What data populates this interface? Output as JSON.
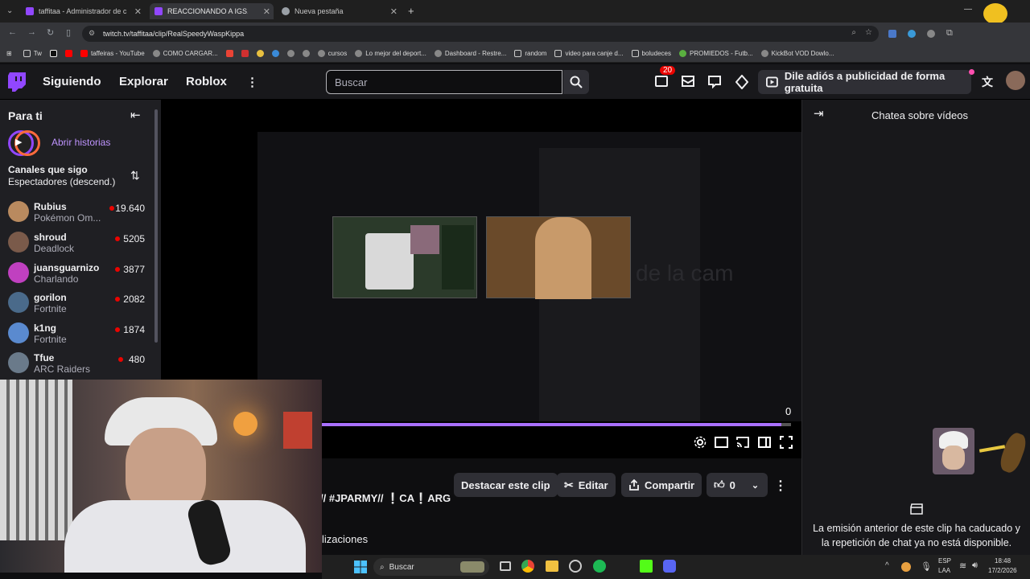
{
  "browser": {
    "tabs": [
      {
        "title": "taffitaa - Administrador de clip",
        "active": false
      },
      {
        "title": "REACCIONANDO A IGS...",
        "active": true
      },
      {
        "title": "Nueva pestaña",
        "active": false
      }
    ],
    "url": "twitch.tv/taffitaa/clip/RealSpeedyWaspKippa",
    "bookmarks": [
      "Tw",
      "taffeiras - YouTube",
      "COMO CARGAR...",
      "cursos",
      "Lo mejor del deport...",
      "Dashboard - Restre...",
      "random",
      "video para canje d...",
      "boludeces",
      "PROMIEDOS - Futb...",
      "KickBot VOD Dowlo..."
    ]
  },
  "topnav": {
    "links": [
      "Siguiendo",
      "Explorar",
      "Roblox"
    ],
    "search_placeholder": "Buscar",
    "notif_count": "20",
    "ad_label": "Dile adiós a publicidad de forma gratuita"
  },
  "sidebar": {
    "title": "Para ti",
    "stories_label": "Abrir historias",
    "section_title": "Canales que sigo",
    "sort_label": "Espectadores (descend.)",
    "channels": [
      {
        "name": "Rubius",
        "game": "Pokémon Om...",
        "viewers": "19.640",
        "color": "#b98a5f"
      },
      {
        "name": "shroud",
        "game": "Deadlock",
        "viewers": "5205",
        "color": "#7a5a4a"
      },
      {
        "name": "juansguarnizo",
        "game": "Charlando",
        "viewers": "3877",
        "color": "#c040c0"
      },
      {
        "name": "gorilon",
        "game": "Fortnite",
        "viewers": "2082",
        "color": "#4a6a8a"
      },
      {
        "name": "k1ng",
        "game": "Fortnite",
        "viewers": "1874",
        "color": "#5a8acf"
      },
      {
        "name": "Tfue",
        "game": "ARC Raiders",
        "viewers": "480",
        "color": "#6a7a8a"
      }
    ]
  },
  "player": {
    "counter": "0",
    "overlay_text": "de la cam",
    "progress_percent": 98
  },
  "clip_info": {
    "title_fragment": "// #JPARMY// ❕CA❕ARG",
    "views_fragment": "lizaciones",
    "buttons": {
      "highlight": "Destacar este clip",
      "edit": "Editar",
      "share": "Compartir",
      "likes": "0"
    }
  },
  "chat": {
    "title": "Chatea sobre vídeos",
    "expired_message": "La emisión anterior de este clip ha caducado y la repetición de chat ya no está disponible."
  },
  "taskbar": {
    "search_label": "Buscar",
    "lang_top": "ESP",
    "lang_bottom": "LAA",
    "time": "18:48",
    "date": "17/2/2026"
  },
  "colors": {
    "twitch_purple": "#9147ff",
    "live_red": "#eb0400",
    "accent_link": "#bf94ff"
  }
}
